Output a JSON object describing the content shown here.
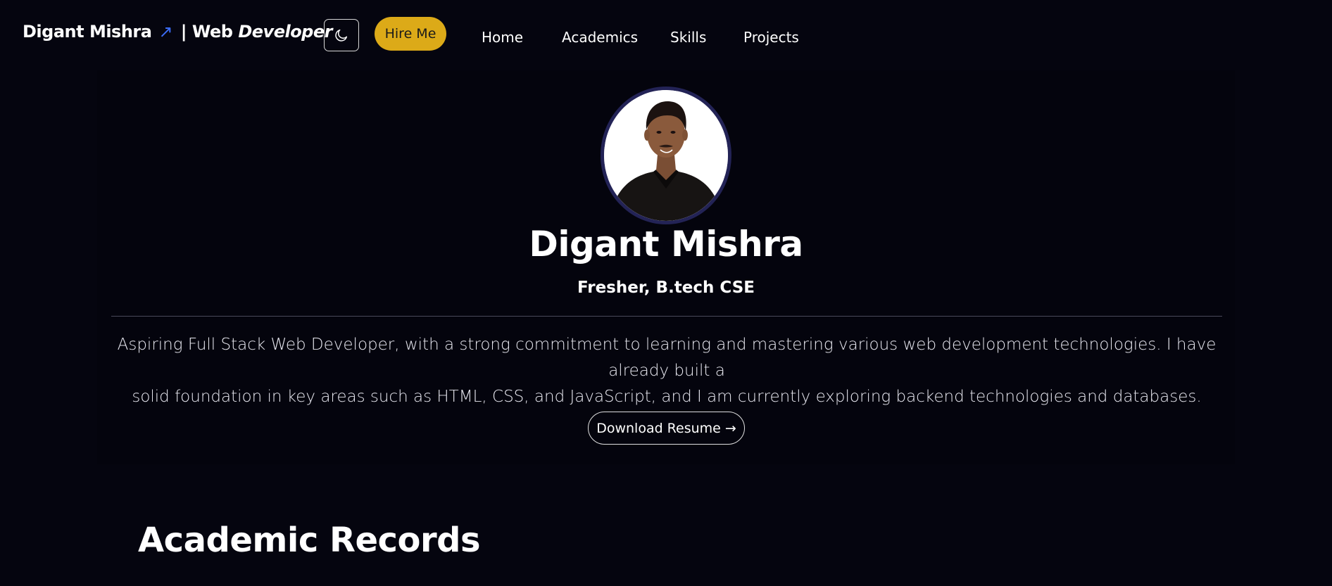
{
  "navbar": {
    "brand_name": "Digant Mishra",
    "brand_arrow": "↗",
    "brand_separator": "| Web",
    "brand_role": "Developer",
    "theme_toggle_icon": "moon-icon",
    "hire_label": "Hire Me",
    "links": [
      "Home",
      "Academics",
      "Skills",
      "Projects"
    ]
  },
  "hero": {
    "avatar_icon": "profile-photo",
    "name": "Digant Mishra",
    "subtitle": "Fresher, B.tech CSE",
    "bio_line1": "Aspiring Full Stack Web Developer, with a strong commitment to learning and mastering various web development technologies. I have already built a",
    "bio_line2": "solid foundation in key areas such as HTML, CSS, and JavaScript, and I am currently exploring backend technologies and databases.",
    "download_label": "Download Resume",
    "download_arrow": "→"
  },
  "sections": {
    "academics_title": "Academic Records"
  },
  "colors": {
    "background": "#05050f",
    "accent_yellow": "#dcaa18",
    "arrow_blue": "#3b6cf6",
    "avatar_ring": "#232356"
  }
}
